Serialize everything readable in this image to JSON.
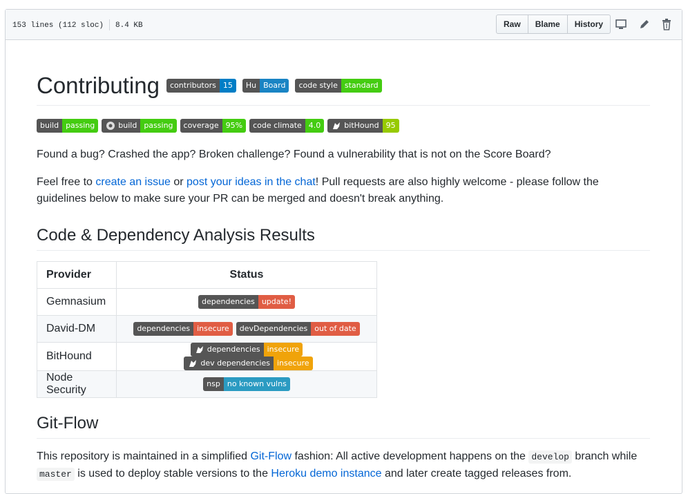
{
  "file": {
    "lines": "153 lines (112 sloc)",
    "size": "8.4 KB"
  },
  "toolbar": {
    "raw": "Raw",
    "blame": "Blame",
    "history": "History"
  },
  "h1": "Contributing",
  "title_badges": [
    {
      "l": "contributors",
      "r": "15",
      "color": "#007ec6"
    },
    {
      "l": "Hu",
      "r": "Board",
      "color": "#1a84c4"
    },
    {
      "l": "code style",
      "r": "standard",
      "color": "#4c1"
    }
  ],
  "status_badges": [
    {
      "l": "build",
      "r": "passing",
      "color": "#4c1"
    },
    {
      "l": "build",
      "r": "passing",
      "color": "#4c1",
      "icon": "appveyor-icon"
    },
    {
      "l": "coverage",
      "r": "95%",
      "color": "#4c1"
    },
    {
      "l": "code climate",
      "r": "4.0",
      "color": "#4c1"
    },
    {
      "l": "bitHound",
      "r": "95",
      "color": "#97ca00",
      "icon": "bithound-icon"
    }
  ],
  "p1": "Found a bug? Crashed the app? Broken challenge? Found a vulnerability that is not on the Score Board?",
  "p2": {
    "a": "Feel free to ",
    "link1": "create an issue",
    "b": " or ",
    "link2": "post your ideas in the chat",
    "c": "! Pull requests are also highly welcome - please follow the guidelines below to make sure your PR can be merged and doesn't break anything."
  },
  "h2_analysis": "Code & Dependency Analysis Results",
  "table": {
    "headers": [
      "Provider",
      "Status"
    ],
    "rows": [
      {
        "provider": "Gemnasium",
        "badges": [
          {
            "l": "dependencies",
            "r": "update!",
            "color": "#e05d44"
          }
        ]
      },
      {
        "provider": "David-DM",
        "badges": [
          {
            "l": "dependencies",
            "r": "insecure",
            "color": "#e05d44"
          },
          {
            "l": "devDependencies",
            "r": "out of date",
            "color": "#e05d44"
          }
        ]
      },
      {
        "provider": "BitHound",
        "badges": [
          {
            "l": "dependencies",
            "r": "insecure",
            "color": "#f0a30a",
            "icon": "bithound-icon"
          },
          {
            "l": "dev dependencies",
            "r": "insecure",
            "color": "#f0a30a",
            "icon": "bithound-icon"
          }
        ]
      },
      {
        "provider": "Node Security",
        "badges": [
          {
            "l": "nsp",
            "r": "no known vulns",
            "color": "#2b9bc2"
          }
        ]
      }
    ]
  },
  "h2_gitflow": "Git-Flow",
  "p3": {
    "a": "This repository is maintained in a simplified ",
    "link1": "Git-Flow",
    "b": " fashion: All active development happens on the ",
    "code1": "develop",
    "c": " branch while ",
    "code2": "master",
    "d": " is used to deploy stable versions to the ",
    "link2": "Heroku demo instance",
    "e": " and later create tagged releases from."
  }
}
